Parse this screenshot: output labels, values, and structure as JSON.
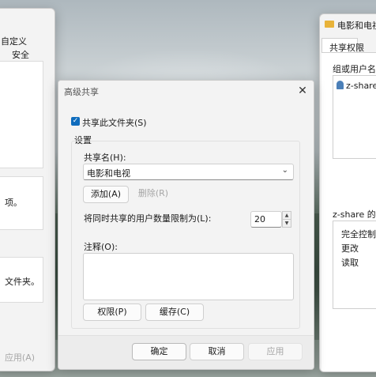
{
  "left_window": {
    "tab_custom": "自定义",
    "tab_security": "安全",
    "text_items": "项。",
    "text_folder": "文件夹。",
    "apply_button": "应用(A)"
  },
  "right_window": {
    "title": "电影和电视",
    "tab_sharing_permissions": "共享权限",
    "group_or_user_label": "组或用户名(",
    "user_entry": "z-share",
    "permissions_label": "z-share 的权",
    "permissions": [
      "完全控制",
      "更改",
      "读取"
    ]
  },
  "dialog": {
    "title": "高级共享",
    "share_checkbox_label": "共享此文件夹(S)",
    "share_checked": true,
    "settings_label": "设置",
    "share_name_label": "共享名(H):",
    "share_name_value": "电影和电视",
    "add_button": "添加(A)",
    "remove_button": "删除(R)",
    "user_limit_label": "将同时共享的用户数量限制为(L):",
    "user_limit_value": "20",
    "comment_label": "注释(O):",
    "comment_value": "",
    "permissions_button": "权限(P)",
    "caching_button": "缓存(C)",
    "ok_button": "确定",
    "cancel_button": "取消",
    "apply_button": "应用"
  },
  "colors": {
    "accent": "#0f6cbd",
    "folder": "#e8b33a"
  }
}
